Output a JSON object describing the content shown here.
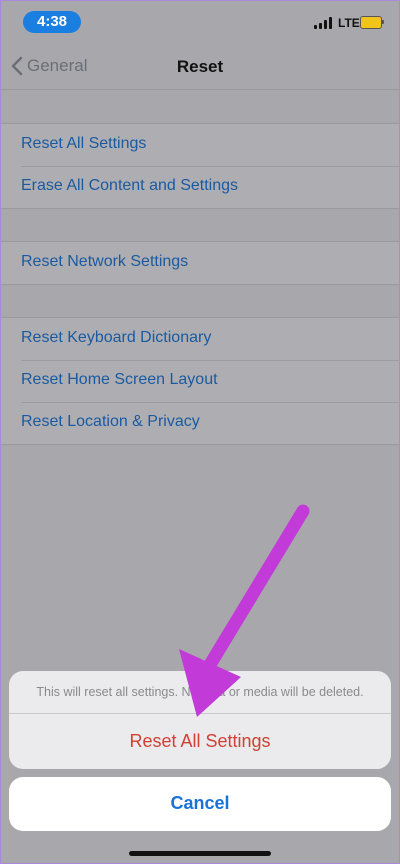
{
  "status_bar": {
    "time": "4:38",
    "network": "LTE",
    "battery_color": "#f0c419"
  },
  "nav": {
    "back_label": "General",
    "title": "Reset"
  },
  "groups": [
    {
      "items": [
        "Reset All Settings",
        "Erase All Content and Settings"
      ]
    },
    {
      "items": [
        "Reset Network Settings"
      ]
    },
    {
      "items": [
        "Reset Keyboard Dictionary",
        "Reset Home Screen Layout",
        "Reset Location & Privacy"
      ]
    }
  ],
  "action_sheet": {
    "message": "This will reset all settings. No data or media will be deleted.",
    "destructive_action": "Reset All Settings",
    "cancel": "Cancel"
  },
  "colors": {
    "link": "#1a5aa0",
    "destructive": "#d23f34",
    "annotation_arrow": "#c23ad8"
  }
}
